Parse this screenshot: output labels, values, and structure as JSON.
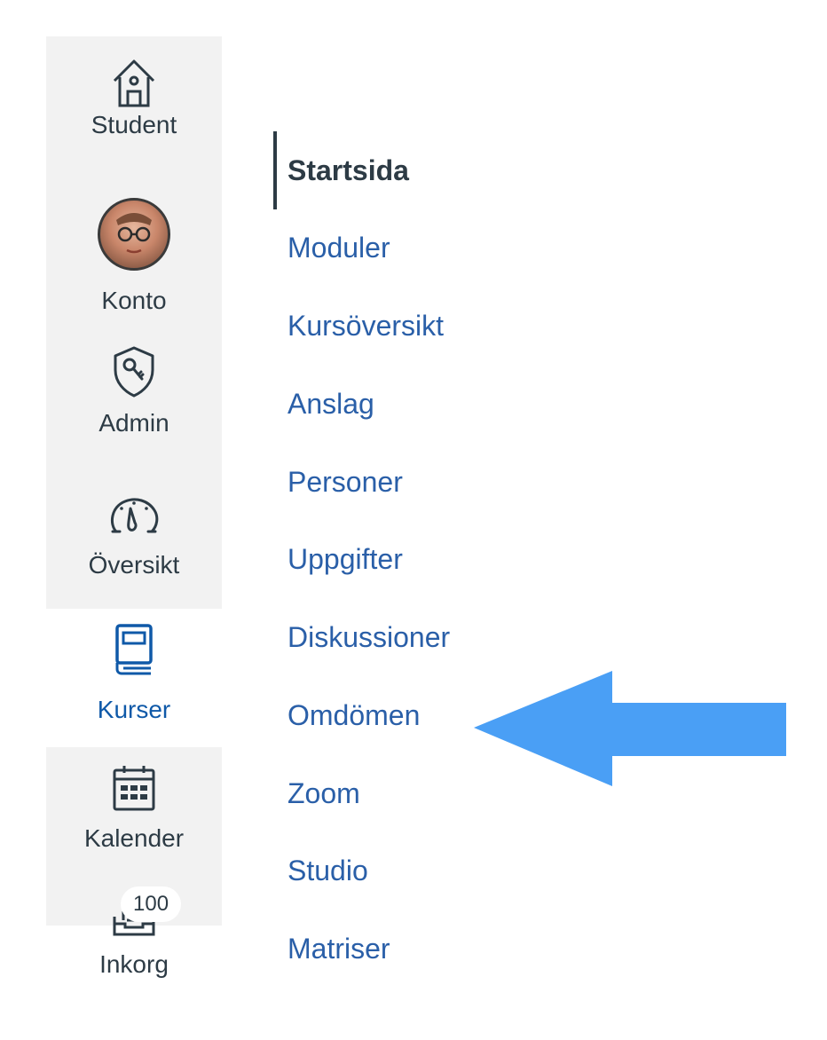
{
  "global_nav": {
    "student_label": "Student",
    "account_label": "Konto",
    "admin_label": "Admin",
    "dashboard_label": "Översikt",
    "courses_label": "Kurser",
    "calendar_label": "Kalender",
    "inbox_label": "Inkorg",
    "inbox_badge": "100"
  },
  "course_nav": {
    "items": [
      {
        "label": "Startsida",
        "active": true
      },
      {
        "label": "Moduler"
      },
      {
        "label": "Kursöversikt"
      },
      {
        "label": "Anslag"
      },
      {
        "label": "Personer"
      },
      {
        "label": "Uppgifter"
      },
      {
        "label": "Diskussioner"
      },
      {
        "label": "Omdömen"
      },
      {
        "label": "Zoom"
      },
      {
        "label": "Studio"
      },
      {
        "label": "Matriser"
      }
    ]
  },
  "colors": {
    "nav_background": "#f2f2f2",
    "link": "#2a5fa8",
    "active_text": "#2d3b45",
    "active_nav_label": "#0f59a8",
    "arrow": "#4a9ff5"
  },
  "icons": [
    "home-icon",
    "avatar",
    "admin-shield-icon",
    "dashboard-icon",
    "courses-book-icon",
    "calendar-icon",
    "inbox-icon",
    "pointer-arrow"
  ]
}
